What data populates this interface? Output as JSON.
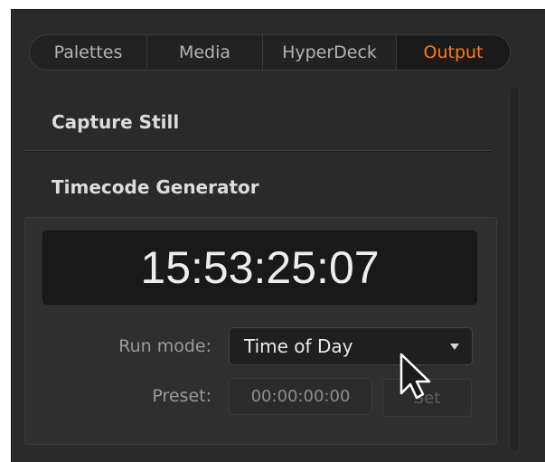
{
  "tabs": [
    {
      "label": "Palettes",
      "active": false
    },
    {
      "label": "Media",
      "active": false
    },
    {
      "label": "HyperDeck",
      "active": false
    },
    {
      "label": "Output",
      "active": true
    }
  ],
  "sections": {
    "capture_still": "Capture Still",
    "timecode_generator": "Timecode Generator"
  },
  "timecode": {
    "value": "15:53:25:07",
    "run_mode_label": "Run mode:",
    "run_mode_value": "Time of Day",
    "preset_label": "Preset:",
    "preset_value": "00:00:00:00",
    "set_label": "Set"
  },
  "colors": {
    "accent": "#ff7a1a",
    "panel": "#2a2a2a",
    "display_bg": "#191919"
  },
  "icons": {
    "dropdown": "chevron-down-icon",
    "pointer": "mouse-pointer-icon"
  }
}
